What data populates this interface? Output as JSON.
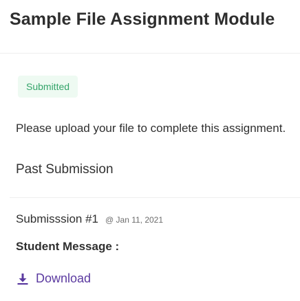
{
  "page": {
    "title": "Sample File Assignment Module"
  },
  "assignment": {
    "status": "Submitted",
    "instructions": "Please upload your file to complete this assignment."
  },
  "past_submission": {
    "heading": "Past Submission",
    "submission_label": "Submisssion #1",
    "submission_date": "@ Jan 11, 2021",
    "message_label": "Student Message :",
    "download_label": "Download",
    "download_icon": "download-icon"
  },
  "colors": {
    "status_text": "#34a46a",
    "status_bg": "#eefaf2",
    "link": "#5b3aa0"
  }
}
